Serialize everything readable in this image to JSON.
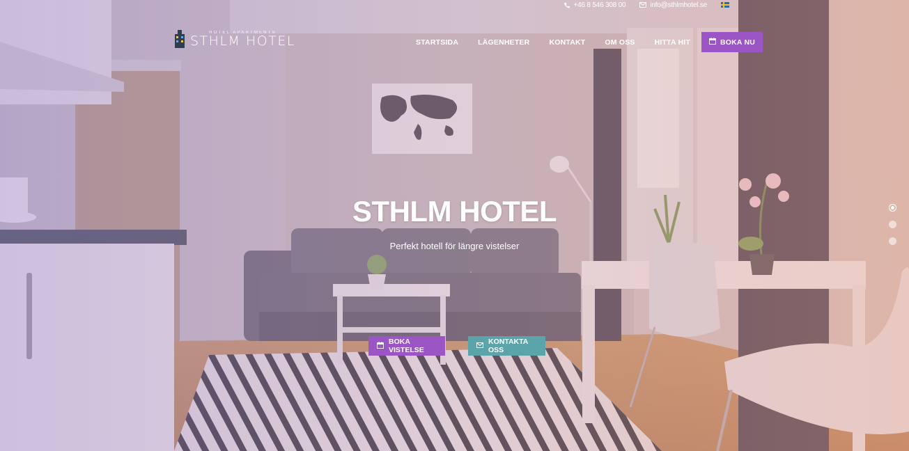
{
  "topbar": {
    "phone_icon": "phone-icon",
    "phone": "+46 8 546 308 00",
    "email_icon": "envelope-icon",
    "email": "info@sthlmhotel.se",
    "language_icon": "swedish-flag-icon"
  },
  "logo": {
    "subtitle": "HOTEL APARTMENTS",
    "title": "STHLM HOTEL"
  },
  "nav": {
    "items": [
      {
        "label": "STARTSIDA"
      },
      {
        "label": "LÄGENHETER"
      },
      {
        "label": "KONTAKT"
      },
      {
        "label": "OM OSS"
      },
      {
        "label": "HITTA HIT"
      }
    ],
    "book_label": "BOKA NU",
    "book_icon": "calendar-icon"
  },
  "hero": {
    "title": "STHLM HOTEL",
    "subtitle": "Perfekt hotell för längre vistelser",
    "cta_primary": "BOKA VISTELSE",
    "cta_primary_icon": "calendar-icon",
    "cta_secondary": "KONTAKTA OSS",
    "cta_secondary_icon": "envelope-icon"
  },
  "slider": {
    "count": 3,
    "active_index": 0
  },
  "colors": {
    "accent_purple": "#9b55c5",
    "accent_teal": "#5aa4aa"
  }
}
